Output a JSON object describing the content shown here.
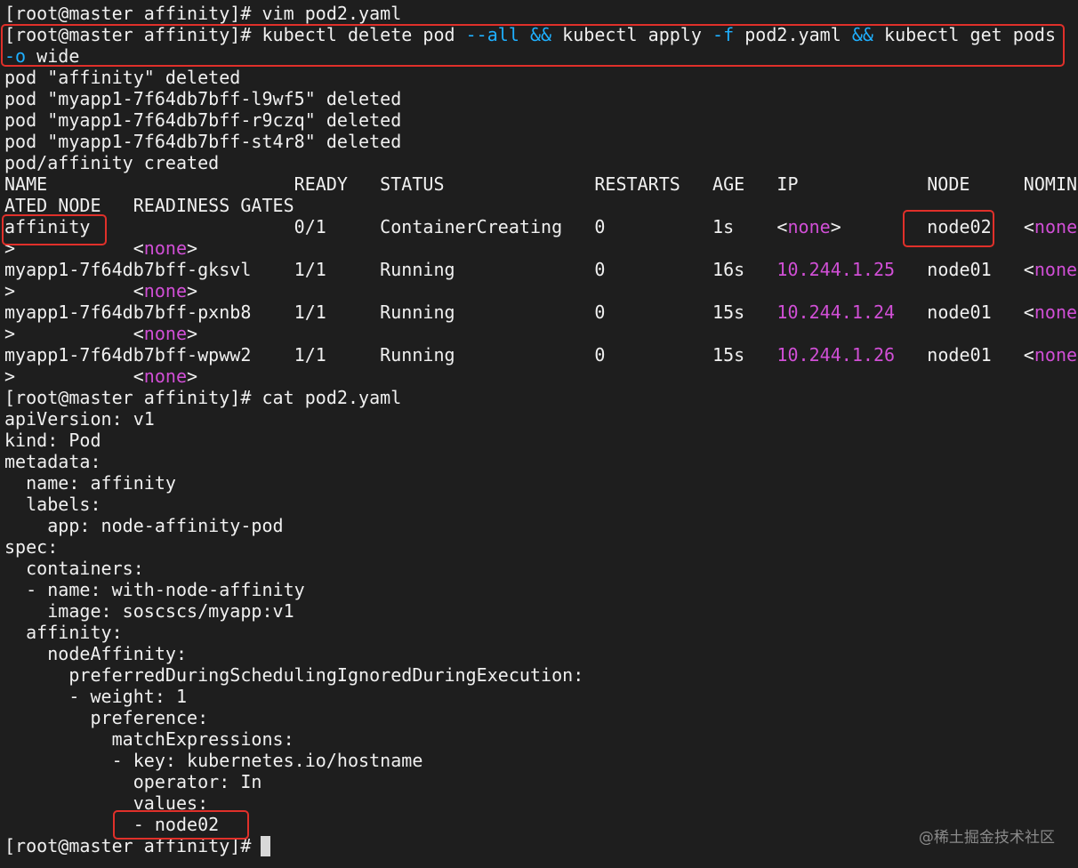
{
  "terminal": {
    "lines": [
      [
        {
          "t": "[root@master affinity]# vim pod2.yaml",
          "c": "default"
        }
      ],
      [
        {
          "t": "[root@master affinity]# kubectl delete pod ",
          "c": "default"
        },
        {
          "t": "--all",
          "c": "cyan"
        },
        {
          "t": " ",
          "c": "default"
        },
        {
          "t": "&&",
          "c": "cyan"
        },
        {
          "t": " kubectl apply ",
          "c": "default"
        },
        {
          "t": "-f",
          "c": "cyan"
        },
        {
          "t": " pod2.yaml ",
          "c": "default"
        },
        {
          "t": "&&",
          "c": "cyan"
        },
        {
          "t": " kubectl get pods",
          "c": "default"
        }
      ],
      [
        {
          "t": "-o",
          "c": "cyan"
        },
        {
          "t": " wide",
          "c": "default"
        }
      ],
      [
        {
          "t": "pod \"affinity\" deleted",
          "c": "default"
        }
      ],
      [
        {
          "t": "pod \"myapp1-7f64db7bff-l9wf5\" deleted",
          "c": "default"
        }
      ],
      [
        {
          "t": "pod \"myapp1-7f64db7bff-r9czq\" deleted",
          "c": "default"
        }
      ],
      [
        {
          "t": "pod \"myapp1-7f64db7bff-st4r8\" deleted",
          "c": "default"
        }
      ],
      [
        {
          "t": "pod/affinity created",
          "c": "default"
        }
      ],
      [
        {
          "t": "NAME                       READY   STATUS              RESTARTS   AGE   IP            NODE     NOMIN",
          "c": "default"
        }
      ],
      [
        {
          "t": "ATED NODE   READINESS GATES",
          "c": "default"
        }
      ],
      [
        {
          "t": "affinity                   0/1     ContainerCreating   0          1s    <",
          "c": "default"
        },
        {
          "t": "none",
          "c": "magenta"
        },
        {
          "t": ">        node02   <",
          "c": "default"
        },
        {
          "t": "none",
          "c": "magenta"
        }
      ],
      [
        {
          "t": ">           <",
          "c": "default"
        },
        {
          "t": "none",
          "c": "magenta"
        },
        {
          "t": ">",
          "c": "default"
        }
      ],
      [
        {
          "t": "myapp1-7f64db7bff-gksvl    1/1     Running             0          16s   ",
          "c": "default"
        },
        {
          "t": "10.244.1.25",
          "c": "magenta"
        },
        {
          "t": "   node01   <",
          "c": "default"
        },
        {
          "t": "none",
          "c": "magenta"
        }
      ],
      [
        {
          "t": ">           <",
          "c": "default"
        },
        {
          "t": "none",
          "c": "magenta"
        },
        {
          "t": ">",
          "c": "default"
        }
      ],
      [
        {
          "t": "myapp1-7f64db7bff-pxnb8    1/1     Running             0          15s   ",
          "c": "default"
        },
        {
          "t": "10.244.1.24",
          "c": "magenta"
        },
        {
          "t": "   node01   <",
          "c": "default"
        },
        {
          "t": "none",
          "c": "magenta"
        }
      ],
      [
        {
          "t": ">           <",
          "c": "default"
        },
        {
          "t": "none",
          "c": "magenta"
        },
        {
          "t": ">",
          "c": "default"
        }
      ],
      [
        {
          "t": "myapp1-7f64db7bff-wpww2    1/1     Running             0          15s   ",
          "c": "default"
        },
        {
          "t": "10.244.1.26",
          "c": "magenta"
        },
        {
          "t": "   node01   <",
          "c": "default"
        },
        {
          "t": "none",
          "c": "magenta"
        }
      ],
      [
        {
          "t": ">           <",
          "c": "default"
        },
        {
          "t": "none",
          "c": "magenta"
        },
        {
          "t": ">",
          "c": "default"
        }
      ],
      [
        {
          "t": "[root@master affinity]# cat pod2.yaml",
          "c": "default"
        }
      ],
      [
        {
          "t": "apiVersion: v1",
          "c": "default"
        }
      ],
      [
        {
          "t": "kind: Pod",
          "c": "default"
        }
      ],
      [
        {
          "t": "metadata:",
          "c": "default"
        }
      ],
      [
        {
          "t": "  name: affinity",
          "c": "default"
        }
      ],
      [
        {
          "t": "  labels:",
          "c": "default"
        }
      ],
      [
        {
          "t": "    app: node-affinity-pod",
          "c": "default"
        }
      ],
      [
        {
          "t": "spec:",
          "c": "default"
        }
      ],
      [
        {
          "t": "  containers:",
          "c": "default"
        }
      ],
      [
        {
          "t": "  - name: with-node-affinity",
          "c": "default"
        }
      ],
      [
        {
          "t": "    image: soscscs/myapp:v1",
          "c": "default"
        }
      ],
      [
        {
          "t": "  affinity:",
          "c": "default"
        }
      ],
      [
        {
          "t": "    nodeAffinity:",
          "c": "default"
        }
      ],
      [
        {
          "t": "      preferredDuringSchedulingIgnoredDuringExecution:",
          "c": "default"
        }
      ],
      [
        {
          "t": "      - weight: 1",
          "c": "default"
        }
      ],
      [
        {
          "t": "        preference:",
          "c": "default"
        }
      ],
      [
        {
          "t": "          matchExpressions:",
          "c": "default"
        }
      ],
      [
        {
          "t": "          - key: kubernetes.io/hostname",
          "c": "default"
        }
      ],
      [
        {
          "t": "            operator: In",
          "c": "default"
        }
      ],
      [
        {
          "t": "            values:",
          "c": "default"
        }
      ],
      [
        {
          "t": "            - node02",
          "c": "default"
        }
      ],
      [
        {
          "t": "[root@master affinity]# ",
          "c": "default"
        }
      ]
    ]
  },
  "colors": {
    "background": "#1e1e1e",
    "foreground": "#f0f0f0",
    "option_flag": "#1fb0ff",
    "highlight_value": "#d14fd6",
    "annotation_box": "#e0302a"
  },
  "watermark": "@稀土掘金技术社区",
  "icons": {
    "cursor": "block-cursor-icon"
  }
}
